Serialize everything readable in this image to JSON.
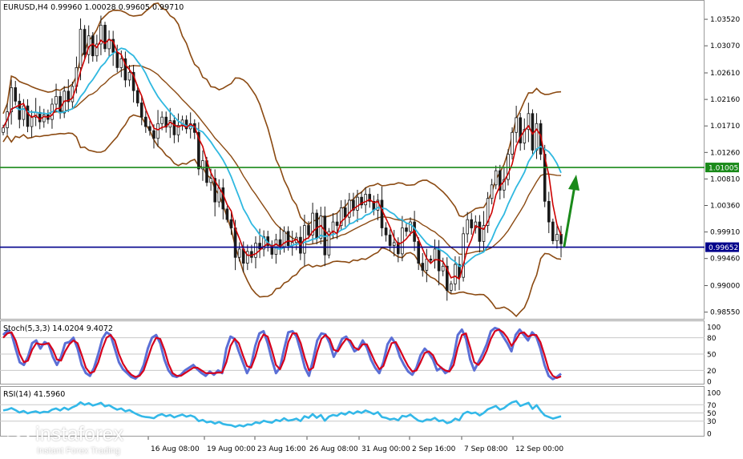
{
  "colors": {
    "candle": "#1a1a1a",
    "ma_fast": "#cc0000",
    "ma_slow": "#2fb8e0",
    "bollinger": "#8b4a12",
    "support": "#00008b",
    "resistance": "#1a8a1a",
    "arrow": "#1a8a1a",
    "stoch_main": "#5b6fd6",
    "stoch_signal": "#d6001c",
    "rsi": "#33b8e8",
    "grid": "#c8c8c8"
  },
  "chart_data": [
    {
      "type": "candlestick",
      "title": "EURUSD,H4  0.99960 1.00028 0.99605 0.99710",
      "x_ticks": [
        "16 Aug 08:00",
        "19 Aug 00:00",
        "23 Aug 16:00",
        "26 Aug 08:00",
        "31 Aug 00:00",
        "2 Sep 16:00",
        "7 Sep 08:00",
        "12 Sep 00:00"
      ],
      "y_ticks": [
        "1.03520",
        "1.03070",
        "1.02610",
        "1.02160",
        "1.01710",
        "1.01260",
        "1.00810",
        "1.00360",
        "0.99910",
        "0.99460",
        "0.99000",
        "0.98550"
      ],
      "ylim": [
        0.9845,
        1.0382
      ],
      "horizontal_levels": [
        {
          "label": "1.01005",
          "value": 1.01005,
          "role": "resistance"
        },
        {
          "label": "0.99652",
          "value": 0.99652,
          "role": "support"
        }
      ],
      "annotation": "upward arrow",
      "closes": [
        1.0168,
        1.0195,
        1.0236,
        1.0213,
        1.0182,
        1.0205,
        1.017,
        1.0186,
        1.0194,
        1.0178,
        1.019,
        1.0182,
        1.0208,
        1.0221,
        1.0193,
        1.023,
        1.0212,
        1.0238,
        1.027,
        1.0335,
        1.0292,
        1.0324,
        1.029,
        1.031,
        1.0342,
        1.0302,
        1.0318,
        1.0296,
        1.027,
        1.0285,
        1.0249,
        1.0262,
        1.0231,
        1.021,
        1.0186,
        1.017,
        1.0163,
        1.015,
        1.0175,
        1.0186,
        1.0169,
        1.018,
        1.0156,
        1.0172,
        1.0181,
        1.0166,
        1.0175,
        1.016,
        1.0098,
        1.0112,
        1.0075,
        1.0082,
        1.0042,
        1.0066,
        1.003,
        1.0012,
        0.9998,
        0.9948,
        0.9962,
        0.9938,
        0.9958,
        0.9948,
        0.9972,
        0.9962,
        0.9983,
        0.9968,
        0.9953,
        0.9978,
        0.9966,
        0.9992,
        0.9968,
        0.9973,
        0.9982,
        0.9955,
        1.0002,
        0.9986,
        1.0023,
        0.998,
        1.0018,
        0.9952,
        0.9992,
        1.0008,
        1.0002,
        1.0032,
        1.0016,
        1.0045,
        1.0028,
        1.005,
        1.0037,
        1.0055,
        1.0043,
        1.0028,
        1.0045,
        0.9998,
        0.9986,
        0.9968,
        0.9973,
        0.9954,
        0.9998,
        0.9992,
        1.0008,
        0.9975,
        0.9938,
        0.9926,
        0.9945,
        0.9943,
        0.9962,
        0.9925,
        0.9933,
        0.9892,
        0.9903,
        0.9936,
        0.9914,
        0.9988,
        1.0012,
        0.9998,
        1.0008,
        0.9975,
        1.0002,
        1.0048,
        1.0071,
        1.0095,
        1.0062,
        1.008,
        1.0123,
        1.016,
        1.0185,
        1.0142,
        1.0165,
        1.0192,
        1.013,
        1.0175,
        1.0123,
        1.0043,
        1.0008,
        0.9976,
        0.9987,
        0.9971
      ]
    },
    {
      "type": "line",
      "title": "Stoch(5,3,3) 14.0204 9.4072",
      "y_ticks": [
        "100",
        "80",
        "50",
        "20",
        "0"
      ],
      "levels": [
        80,
        50,
        20
      ],
      "ylim": [
        0,
        100
      ],
      "series": [
        {
          "name": "main",
          "values": [
            85,
            93,
            88,
            60,
            35,
            30,
            45,
            70,
            75,
            60,
            72,
            68,
            45,
            30,
            45,
            70,
            72,
            80,
            60,
            30,
            15,
            10,
            25,
            50,
            78,
            90,
            85,
            60,
            35,
            22,
            15,
            8,
            5,
            12,
            30,
            60,
            80,
            85,
            70,
            40,
            20,
            10,
            8,
            12,
            20,
            25,
            30,
            22,
            15,
            10,
            18,
            12,
            20,
            15,
            60,
            82,
            78,
            55,
            35,
            15,
            30,
            65,
            88,
            92,
            70,
            40,
            15,
            25,
            60,
            90,
            92,
            82,
            55,
            25,
            10,
            40,
            75,
            88,
            86,
            70,
            45,
            60,
            78,
            82,
            70,
            55,
            60,
            75,
            62,
            40,
            25,
            15,
            35,
            68,
            80,
            68,
            45,
            30,
            18,
            12,
            25,
            48,
            60,
            52,
            40,
            20,
            25,
            15,
            20,
            45,
            85,
            95,
            78,
            40,
            20,
            35,
            50,
            68,
            92,
            98,
            95,
            82,
            70,
            55,
            85,
            95,
            85,
            75,
            90,
            82,
            60,
            30,
            10,
            4,
            8,
            14
          ]
        },
        {
          "name": "signal",
          "values": [
            80,
            88,
            90,
            75,
            50,
            35,
            38,
            58,
            70,
            68,
            68,
            70,
            58,
            40,
            38,
            55,
            68,
            75,
            70,
            48,
            25,
            15,
            18,
            35,
            60,
            80,
            85,
            75,
            50,
            32,
            20,
            12,
            8,
            10,
            20,
            42,
            65,
            80,
            78,
            58,
            32,
            15,
            10,
            10,
            15,
            20,
            25,
            25,
            20,
            15,
            15,
            15,
            16,
            16,
            35,
            65,
            78,
            70,
            48,
            28,
            25,
            45,
            72,
            86,
            82,
            58,
            30,
            22,
            40,
            72,
            88,
            88,
            70,
            42,
            20,
            25,
            55,
            78,
            85,
            78,
            58,
            55,
            68,
            78,
            75,
            62,
            58,
            68,
            68,
            52,
            35,
            22,
            28,
            50,
            70,
            72,
            58,
            42,
            28,
            18,
            20,
            35,
            52,
            55,
            48,
            32,
            25,
            20,
            18,
            30,
            62,
            85,
            88,
            62,
            35,
            30,
            40,
            56,
            78,
            92,
            95,
            90,
            80,
            65,
            75,
            88,
            90,
            82,
            85,
            85,
            72,
            48,
            22,
            10,
            6,
            9
          ]
        }
      ]
    },
    {
      "type": "line",
      "title": "RSI(14) 41.5960",
      "y_ticks": [
        "100",
        "70",
        "50",
        "30",
        "0"
      ],
      "levels": [
        70,
        50,
        30
      ],
      "ylim": [
        0,
        100
      ],
      "series": [
        {
          "name": "rsi",
          "values": [
            56,
            58,
            62,
            57,
            51,
            55,
            49,
            52,
            54,
            50,
            53,
            52,
            58,
            61,
            56,
            63,
            58,
            64,
            68,
            76,
            70,
            74,
            68,
            71,
            75,
            66,
            69,
            63,
            58,
            61,
            54,
            57,
            51,
            46,
            42,
            40,
            39,
            37,
            44,
            47,
            42,
            45,
            39,
            43,
            46,
            41,
            44,
            40,
            30,
            33,
            27,
            29,
            24,
            28,
            23,
            21,
            20,
            16,
            20,
            17,
            22,
            21,
            27,
            25,
            31,
            28,
            26,
            33,
            30,
            37,
            31,
            33,
            36,
            30,
            42,
            38,
            47,
            38,
            45,
            31,
            41,
            45,
            43,
            50,
            46,
            53,
            48,
            54,
            50,
            56,
            52,
            47,
            52,
            40,
            38,
            34,
            36,
            32,
            43,
            41,
            46,
            38,
            31,
            29,
            34,
            33,
            38,
            30,
            32,
            25,
            28,
            36,
            32,
            48,
            53,
            49,
            51,
            44,
            50,
            59,
            63,
            67,
            58,
            62,
            70,
            76,
            79,
            67,
            71,
            75,
            60,
            69,
            55,
            44,
            40,
            36,
            39,
            42
          ]
        }
      ]
    }
  ],
  "branding": {
    "name": "instaforex",
    "tagline": "Instant Forex Trading"
  }
}
